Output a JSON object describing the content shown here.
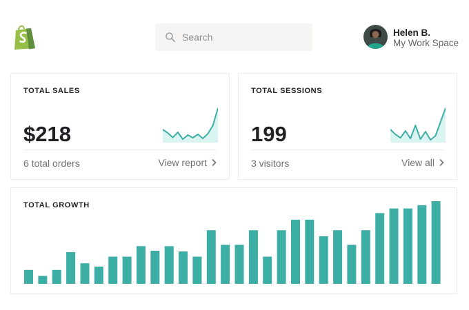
{
  "colors": {
    "accent": "#3daea5",
    "accent_light": "#d9f4f1",
    "logo": "#95bf47"
  },
  "header": {
    "logo_icon": "shopify-bag-icon",
    "search": {
      "placeholder": "Search",
      "icon": "search-icon"
    },
    "user": {
      "name": "Helen B.",
      "workspace": "My Work Space",
      "avatar": "user-avatar"
    }
  },
  "cards": {
    "sales": {
      "title": "TOTAL SALES",
      "value": "$218",
      "sub": "6 total orders",
      "link": "View report",
      "spark": [
        0.62,
        0.72,
        0.85,
        0.7,
        0.9,
        0.78,
        0.86,
        0.76,
        0.88,
        0.74,
        0.5,
        0.0
      ]
    },
    "sessions": {
      "title": "TOTAL SESSIONS",
      "value": "199",
      "sub": "3 visitors",
      "link": "View all",
      "spark": [
        0.62,
        0.76,
        0.86,
        0.66,
        0.88,
        0.5,
        0.9,
        0.68,
        0.92,
        0.8,
        0.4,
        0.0
      ]
    },
    "growth": {
      "title": "TOTAL GROWTH"
    }
  },
  "chart_data": {
    "type": "bar",
    "title": "TOTAL GROWTH",
    "values": [
      21,
      12,
      21,
      48,
      31,
      26,
      41,
      41,
      57,
      50,
      57,
      49,
      41,
      81,
      59,
      59,
      81,
      41,
      81,
      97,
      97,
      72,
      81,
      59,
      81,
      107,
      114,
      114,
      119,
      125
    ],
    "ylim": [
      0,
      125
    ],
    "grid": false
  }
}
